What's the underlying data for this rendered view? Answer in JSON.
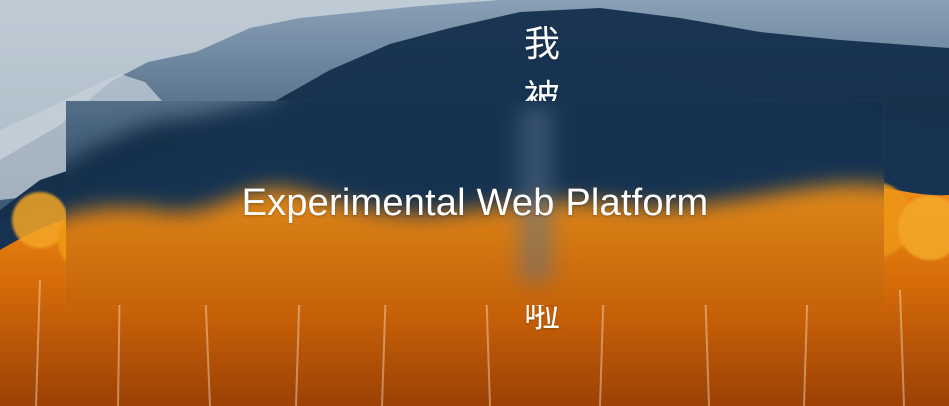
{
  "page": {
    "title": "Experimental Web Platform",
    "vertical_text": {
      "char_1": "我",
      "char_2": "被",
      "char_3": "啦"
    },
    "background_theme": "mountain-autumn-forest"
  }
}
